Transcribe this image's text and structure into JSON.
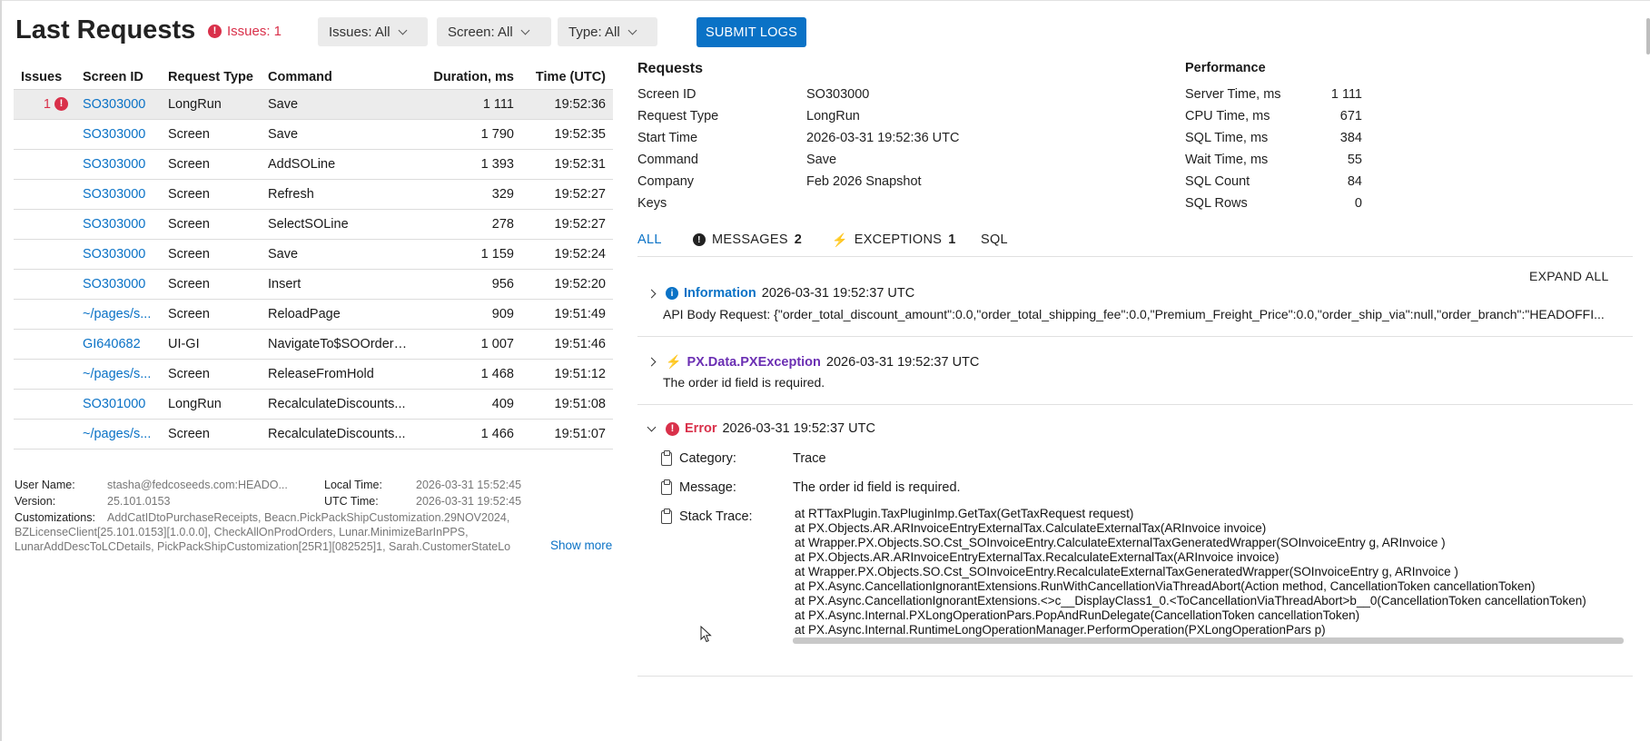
{
  "header": {
    "title": "Last Requests",
    "issues_badge": "Issues: 1",
    "filters": [
      "Issues: All",
      "Screen: All",
      "Type: All"
    ],
    "submit_label": "SUBMIT LOGS"
  },
  "table": {
    "columns": [
      "Issues",
      "Screen ID",
      "Request Type",
      "Command",
      "Duration, ms",
      "Time (UTC)"
    ],
    "rows": [
      {
        "issues": "1",
        "screen": "SO303000",
        "type": "LongRun",
        "command": "Save",
        "duration": "1 111",
        "time": "19:52:36"
      },
      {
        "issues": "",
        "screen": "SO303000",
        "type": "Screen",
        "command": "Save",
        "duration": "1 790",
        "time": "19:52:35"
      },
      {
        "issues": "",
        "screen": "SO303000",
        "type": "Screen",
        "command": "AddSOLine",
        "duration": "1 393",
        "time": "19:52:31"
      },
      {
        "issues": "",
        "screen": "SO303000",
        "type": "Screen",
        "command": "Refresh",
        "duration": "329",
        "time": "19:52:27"
      },
      {
        "issues": "",
        "screen": "SO303000",
        "type": "Screen",
        "command": "SelectSOLine",
        "duration": "278",
        "time": "19:52:27"
      },
      {
        "issues": "",
        "screen": "SO303000",
        "type": "Screen",
        "command": "Save",
        "duration": "1 159",
        "time": "19:52:24"
      },
      {
        "issues": "",
        "screen": "SO303000",
        "type": "Screen",
        "command": "Insert",
        "duration": "956",
        "time": "19:52:20"
      },
      {
        "issues": "",
        "screen": "~/pages/s...",
        "type": "Screen",
        "command": "ReloadPage",
        "duration": "909",
        "time": "19:51:49"
      },
      {
        "issues": "",
        "screen": "GI640682",
        "type": "UI-GI",
        "command": "NavigateTo$SOOrder_...",
        "duration": "1 007",
        "time": "19:51:46"
      },
      {
        "issues": "",
        "screen": "~/pages/s...",
        "type": "Screen",
        "command": "ReleaseFromHold",
        "duration": "1 468",
        "time": "19:51:12"
      },
      {
        "issues": "",
        "screen": "SO301000",
        "type": "LongRun",
        "command": "RecalculateDiscounts...",
        "duration": "409",
        "time": "19:51:08"
      },
      {
        "issues": "",
        "screen": "~/pages/s...",
        "type": "Screen",
        "command": "RecalculateDiscounts...",
        "duration": "1 466",
        "time": "19:51:07"
      }
    ]
  },
  "footer": {
    "user_name_label": "User Name:",
    "user_name": "stasha@fedcoseeds.com:HEADO...",
    "version_label": "Version:",
    "version": "25.101.0153",
    "local_time_label": "Local Time:",
    "local_time": "2026-03-31 15:52:45",
    "utc_time_label": "UTC Time:",
    "utc_time": "2026-03-31 19:52:45",
    "customizations_label": "Customizations:",
    "customizations_line1": "AddCatIDtoPurchaseReceipts, Beacn.PickPackShipCustomization.29NOV2024,",
    "customizations_line2": "BZLicenseClient[25.101.0153][1.0.0.0], CheckAllOnProdOrders, Lunar.MinimizeBarInPPS,",
    "customizations_line3": "LunarAddDescToLCDetails, PickPackShipCustomization[25R1][082525]1, Sarah.CustomerStateLo",
    "show_more": "Show more"
  },
  "requests": {
    "title": "Requests",
    "screen_id_label": "Screen ID",
    "screen_id": "SO303000",
    "request_type_label": "Request Type",
    "request_type": "LongRun",
    "start_time_label": "Start Time",
    "start_time": "2026-03-31 19:52:36 UTC",
    "command_label": "Command",
    "command": "Save",
    "company_label": "Company",
    "company": "Feb 2026 Snapshot",
    "keys_label": "Keys",
    "keys": ""
  },
  "performance": {
    "title": "Performance",
    "items": [
      {
        "label": "Server Time, ms",
        "value": "1 111"
      },
      {
        "label": "CPU Time, ms",
        "value": "671"
      },
      {
        "label": "SQL Time, ms",
        "value": "384"
      },
      {
        "label": "Wait Time, ms",
        "value": "55"
      },
      {
        "label": "SQL Count",
        "value": "84"
      },
      {
        "label": "SQL Rows",
        "value": "0"
      }
    ]
  },
  "tabs": {
    "all": "ALL",
    "messages": "MESSAGES",
    "messages_count": "2",
    "exceptions": "EXCEPTIONS",
    "exceptions_count": "1",
    "sql": "SQL"
  },
  "expand_all": "EXPAND ALL",
  "log": {
    "info": {
      "label": "Information",
      "time": "2026-03-31 19:52:37 UTC",
      "body": "API Body Request: {\"order_total_discount_amount\":0.0,\"order_total_shipping_fee\":0.0,\"Premium_Freight_Price\":0.0,\"order_ship_via\":null,\"order_branch\":\"HEADOFFI..."
    },
    "exception": {
      "label": "PX.Data.PXException",
      "time": "2026-03-31 19:52:37 UTC",
      "body": "The order id field is required."
    },
    "error": {
      "label": "Error",
      "time": "2026-03-31 19:52:37 UTC",
      "category_label": "Category:",
      "category": "Trace",
      "message_label": "Message:",
      "message": "The order id field is required.",
      "stack_label": "Stack Trace:",
      "stack": "at RTTaxPlugin.TaxPluginImp.GetTax(GetTaxRequest request)\nat PX.Objects.AR.ARInvoiceEntryExternalTax.CalculateExternalTax(ARInvoice invoice)\nat Wrapper.PX.Objects.SO.Cst_SOInvoiceEntry.CalculateExternalTaxGeneratedWrapper(SOInvoiceEntry g, ARInvoice )\nat PX.Objects.AR.ARInvoiceEntryExternalTax.RecalculateExternalTax(ARInvoice invoice)\nat Wrapper.PX.Objects.SO.Cst_SOInvoiceEntry.RecalculateExternalTaxGeneratedWrapper(SOInvoiceEntry g, ARInvoice )\nat PX.Async.CancellationIgnorantExtensions.RunWithCancellationViaThreadAbort(Action method, CancellationToken cancellationToken)\nat PX.Async.CancellationIgnorantExtensions.<>c__DisplayClass1_0.<ToCancellationViaThreadAbort>b__0(CancellationToken cancellationToken)\nat PX.Async.Internal.PXLongOperationPars.PopAndRunDelegate(CancellationToken cancellationToken)\nat PX.Async.Internal.RuntimeLongOperationManager.PerformOperation(PXLongOperationPars p)"
    }
  },
  "colors": {
    "accent": "#0a72c6",
    "error": "#d9304a",
    "exception": "#6b2fb3"
  }
}
